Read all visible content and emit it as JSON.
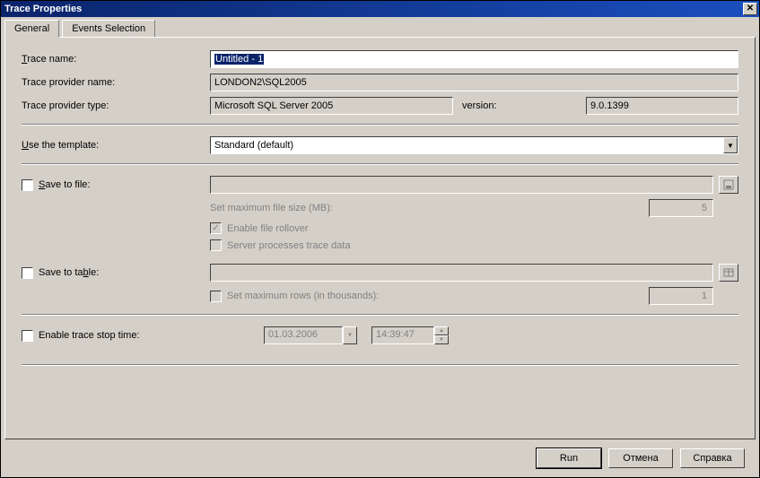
{
  "window": {
    "title": "Trace Properties"
  },
  "tabs": {
    "general": "General",
    "events": "Events Selection"
  },
  "labels": {
    "trace_name": "Trace name:",
    "provider_name": "Trace provider name:",
    "provider_type": "Trace provider type:",
    "version": "version:",
    "use_template": "Use the template:",
    "save_file": "Save to file:",
    "max_fs": "Set maximum file size (MB):",
    "rollover": "Enable file rollover",
    "server_proc": "Server processes trace data",
    "save_table": "Save to table:",
    "max_rows": "Set maximum rows (in thousands):",
    "stop_time": "Enable trace stop time:"
  },
  "values": {
    "trace_name": "Untitled - 1",
    "provider_name": "LONDON2\\SQL2005",
    "provider_type": "Microsoft SQL Server 2005",
    "version": "9.0.1399",
    "template": "Standard (default)",
    "file_path": "",
    "max_fs": "5",
    "table_path": "",
    "max_rows": "1",
    "stop_date": "01.03.2006",
    "stop_time": "14:39:47"
  },
  "checks": {
    "save_file": false,
    "rollover": true,
    "server_proc": false,
    "save_table": false,
    "max_rows": false,
    "stop_time": false
  },
  "buttons": {
    "run": "Run",
    "cancel": "Отмена",
    "help": "Справка"
  }
}
